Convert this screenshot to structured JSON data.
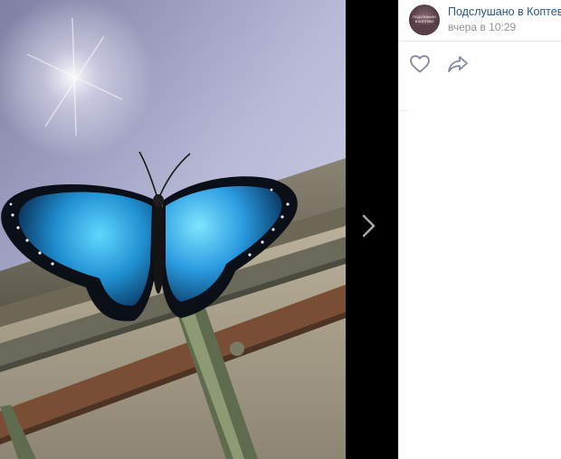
{
  "post": {
    "author_name": "Подслушано в Коптево",
    "time": "вчера в 10:29"
  },
  "avatar_text": {
    "line1": "ПОДСЛУШАНО",
    "line2": "В КОПТЕВО"
  },
  "photo": {
    "subject": "blue morpho butterfly on rusty window grate"
  },
  "icons": {
    "next": "chevron-right-icon",
    "like": "heart-icon",
    "share": "share-arrow-icon"
  },
  "colors": {
    "link": "#2a5885",
    "meta": "#939393",
    "icon": "#828a99",
    "backdrop": "#000000",
    "panel": "#ffffff"
  }
}
